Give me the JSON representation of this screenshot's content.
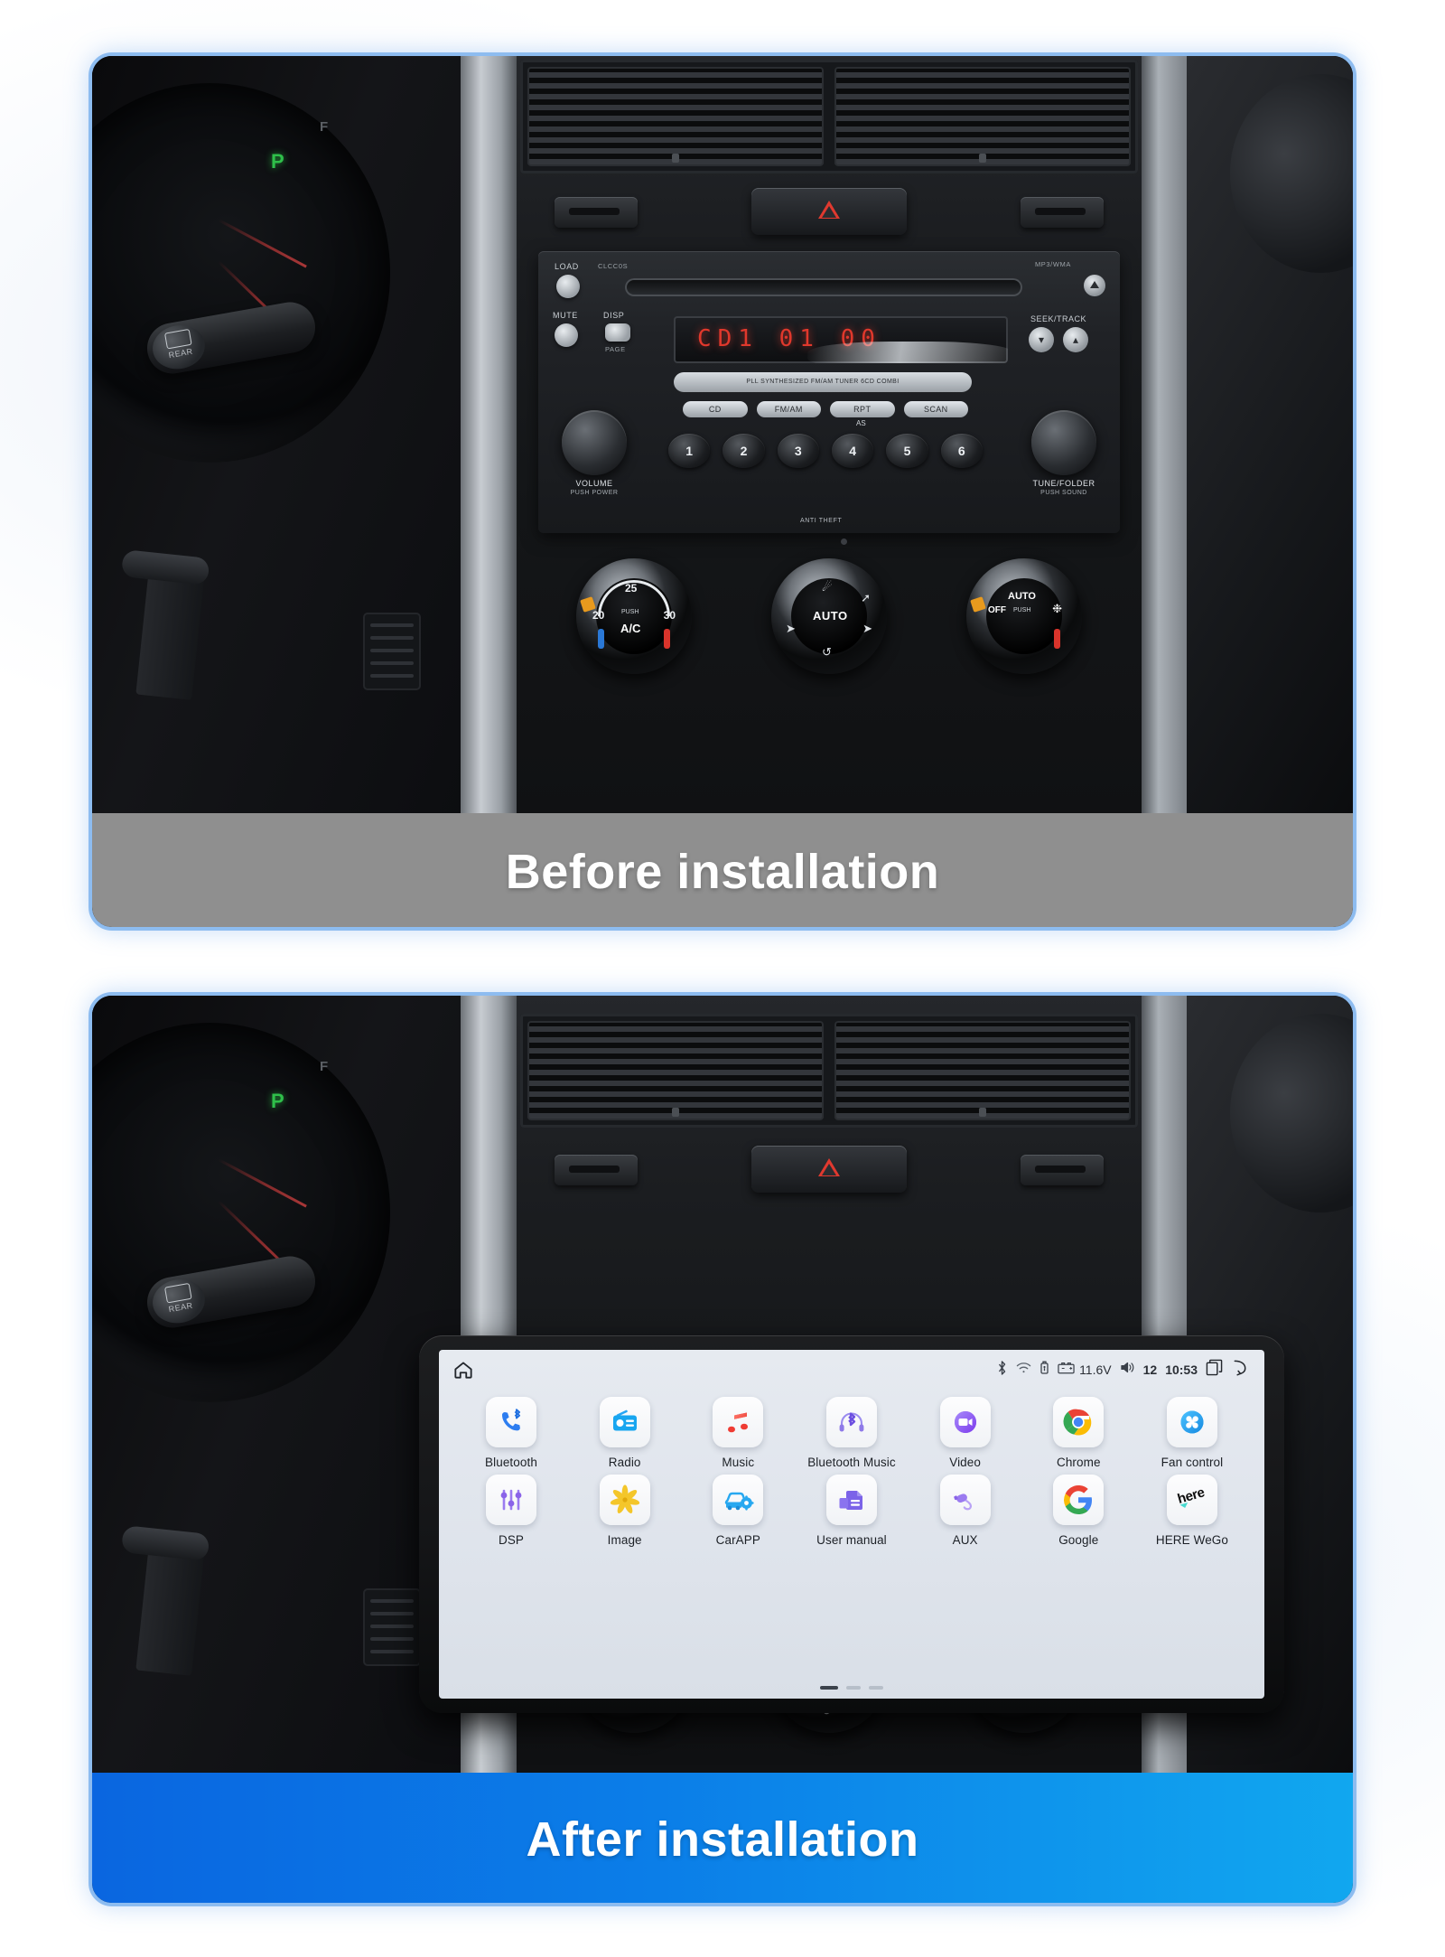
{
  "product_listing": {
    "panels": [
      {
        "id": "before",
        "caption": "Before installation",
        "caption_bg": "#8f8f8f",
        "scene": "suzuki-grand-vitara-dashboard-factory-radio"
      },
      {
        "id": "after",
        "caption": "After installation",
        "caption_bg_from": "#0a66e0",
        "caption_bg_to": "#11a7ef",
        "scene": "suzuki-grand-vitara-dashboard-android-head-unit"
      }
    ]
  },
  "factory_radio": {
    "labels": {
      "load": "LOAD",
      "clccos": "CLCC0S",
      "mp3_wma": "MP3/WMA",
      "mute": "MUTE",
      "disp": "DISP",
      "page": "PAGE",
      "seek_track": "SEEK/TRACK",
      "volume": "VOLUME",
      "volume_sub": "PUSH POWER",
      "tune_folder": "TUNE/FOLDER",
      "tune_sub": "PUSH SOUND",
      "anti_theft": "ANTI THEFT",
      "tuner_bar": "PLL SYNTHESIZED FM/AM TUNER 6CD COMBI",
      "as": "AS"
    },
    "display_text": "CD1 01 00",
    "mode_buttons": [
      "CD",
      "FM/AM",
      "RPT",
      "SCAN"
    ],
    "preset_buttons": [
      "1",
      "2",
      "3",
      "4",
      "5",
      "6"
    ]
  },
  "climate": {
    "temp_dial": {
      "left": "20",
      "center": "25",
      "right": "30",
      "push": "PUSH",
      "ac": "A/C"
    },
    "mode_dial": {
      "auto": "AUTO"
    },
    "fan_dial": {
      "auto": "AUTO",
      "off": "OFF",
      "push": "PUSH"
    }
  },
  "cluster": {
    "gear": "P",
    "fuel": "F"
  },
  "stalk": {
    "label": "REAR"
  },
  "head_unit": {
    "status_bar": {
      "home_icon": "home-icon",
      "bluetooth_icon": "bluetooth-icon",
      "wifi_icon": "wifi-icon",
      "usb_icon": "usb-icon",
      "battery_icon": "car-battery-icon",
      "voltage": "11.6V",
      "volume_icon": "volume-icon",
      "volume_level": "12",
      "clock": "10:53",
      "recents_icon": "recents-icon",
      "back_icon": "back-icon"
    },
    "apps": [
      [
        {
          "label": "Bluetooth",
          "icon": "bluetooth-phone-icon"
        },
        {
          "label": "Radio",
          "icon": "radio-icon"
        },
        {
          "label": "Music",
          "icon": "music-note-icon"
        },
        {
          "label": "Bluetooth Music",
          "icon": "bluetooth-headphones-icon"
        },
        {
          "label": "Video",
          "icon": "video-camera-icon"
        },
        {
          "label": "Chrome",
          "icon": "chrome-icon"
        },
        {
          "label": "Fan control",
          "icon": "fan-icon"
        }
      ],
      [
        {
          "label": "DSP",
          "icon": "equalizer-sliders-icon"
        },
        {
          "label": "Image",
          "icon": "flower-gallery-icon"
        },
        {
          "label": "CarAPP",
          "icon": "car-settings-icon"
        },
        {
          "label": "User manual",
          "icon": "document-icon"
        },
        {
          "label": "AUX",
          "icon": "aux-jack-icon"
        },
        {
          "label": "Google",
          "icon": "google-g-icon"
        },
        {
          "label": "HERE WeGo",
          "icon": "here-wego-icon"
        }
      ]
    ],
    "page_indicator": {
      "total": 3,
      "active": 1
    }
  }
}
